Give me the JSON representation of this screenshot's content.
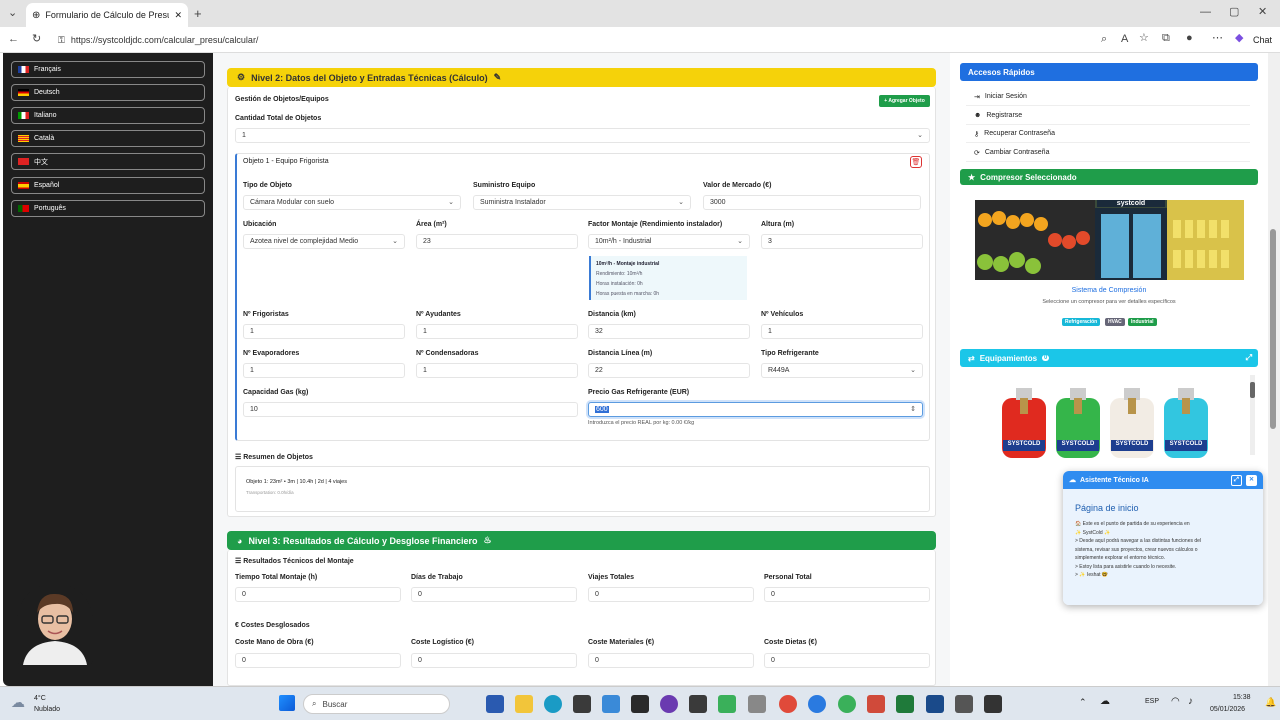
{
  "browser": {
    "tab_title": "Formulario de Cálculo de Presupu",
    "url": "https://systcoldjdc.com/calcular_presu/calcular/",
    "chat_label": "Chat"
  },
  "sidebar": {
    "languages": [
      "Français",
      "Deutsch",
      "Italiano",
      "Català",
      "中文",
      "Español",
      "Português"
    ]
  },
  "level2": {
    "title": "Nivel 2: Datos del Objeto y Entradas Técnicas (Cálculo)",
    "gestion_label": "Gestión de Objetos/Equipos",
    "add_button": "+ Agregar Objeto",
    "cantidad_label": "Cantidad Total de Objetos",
    "cantidad_value": "1",
    "object_title": "Objeto 1 - Equipo Frigorista",
    "tipo_label": "Tipo de Objeto",
    "tipo_value": "Cámara Modular con suelo",
    "suministro_label": "Suministro Equipo",
    "suministro_value": "Suministra Instalador",
    "valor_label": "Valor de Mercado (€)",
    "valor_value": "3000",
    "ubicacion_label": "Ubicación",
    "ubicacion_value": "Azotea nivel de complejidad Medio",
    "area_label": "Área (m²)",
    "area_value": "23",
    "factor_label": "Factor Montaje (Rendimiento instalador)",
    "factor_value": "10m²/h - Industrial",
    "altura_label": "Altura (m)",
    "altura_value": "3",
    "info_title": "10m²/h - Montaje industrial",
    "info_lines": [
      "Rendimiento: 10m²/h",
      "Horas instalación: 0h",
      "Horas puesta en marcha: 0h"
    ],
    "frigoristas_label": "Nº Frigoristas",
    "frigoristas_value": "1",
    "ayudantes_label": "Nº Ayudantes",
    "ayudantes_value": "1",
    "distancia_label": "Distancia (km)",
    "distancia_value": "32",
    "vehiculos_label": "Nº Vehículos",
    "vehiculos_value": "1",
    "evaporadores_label": "Nº Evaporadores",
    "evaporadores_value": "1",
    "condensadoras_label": "Nº Condensadoras",
    "condensadoras_value": "1",
    "dist_linea_label": "Distancia Línea (m)",
    "dist_linea_value": "22",
    "refrigerante_label": "Tipo Refrigerante",
    "refrigerante_value": "R449A",
    "capacidad_label": "Capacidad Gas (kg)",
    "capacidad_value": "10",
    "precio_label": "Precio Gas Refrigerante (EUR)",
    "precio_value": "600",
    "precio_hint": "Introduzca el precio REAL por kg: 0.00 €/kg",
    "resumen_label": "Resumen de Objetos",
    "resumen_line": "Objeto 1: 23m² • 3m | 10.4h | 2d | 4 viajes",
    "resumen_sub": "Transportation: 0.0h/día"
  },
  "level3": {
    "title": "Nivel 3: Resultados de Cálculo y Desglose Financiero",
    "tecnicos_label": "Resultados Técnicos del Montaje",
    "fields": [
      {
        "label": "Tiempo Total Montaje (h)",
        "value": "0"
      },
      {
        "label": "Días de Trabajo",
        "value": "0"
      },
      {
        "label": "Viajes Totales",
        "value": "0"
      },
      {
        "label": "Personal Total",
        "value": "0"
      }
    ],
    "costes_label": "Costes Desglosados",
    "costes": [
      {
        "label": "Coste Mano de Obra (€)",
        "value": "0"
      },
      {
        "label": "Coste Logístico (€)",
        "value": "0"
      },
      {
        "label": "Coste Materiales (€)",
        "value": "0"
      },
      {
        "label": "Coste Dietas (€)",
        "value": "0"
      }
    ]
  },
  "right": {
    "accesos_title": "Accesos Rápidos",
    "accesos": [
      "Iniciar Sesión",
      "Registrarse",
      "Recuperar Contraseña",
      "Cambiar Contraseña"
    ],
    "compresor_title": "Compresor Seleccionado",
    "compresor_brand": "systcold",
    "compresor_name": "Sistema de Compresión",
    "compresor_desc": "Seleccione un compresor para ver detalles específicos",
    "tags": [
      "Refrigeración",
      "HVAC",
      "Industrial"
    ],
    "equip_title": "Equipamientos",
    "equip_count": "0",
    "cyl_label": "SYSTCOLD"
  },
  "assistant": {
    "title": "Asistente Técnico IA",
    "heading": "Página de inicio",
    "lines": [
      "🏠 Este es el punto de partida de su experiencia en",
      "✨ SystCold ✨",
      "> Desde aquí podrá navegar a las distintas funciones del",
      "sistema, revisar sus proyectos, crear nuevos cálculos o",
      "simplemente explorar el entorno técnico.",
      "> Estoy lista para asistirle cuando lo necesite.",
      "> ✨ Ieshat 🤓"
    ]
  },
  "taskbar": {
    "weather_temp": "4°C",
    "weather_desc": "Nublado",
    "search_placeholder": "Buscar",
    "lang": "ESP",
    "time": "15:38",
    "date": "05/01/2026"
  }
}
